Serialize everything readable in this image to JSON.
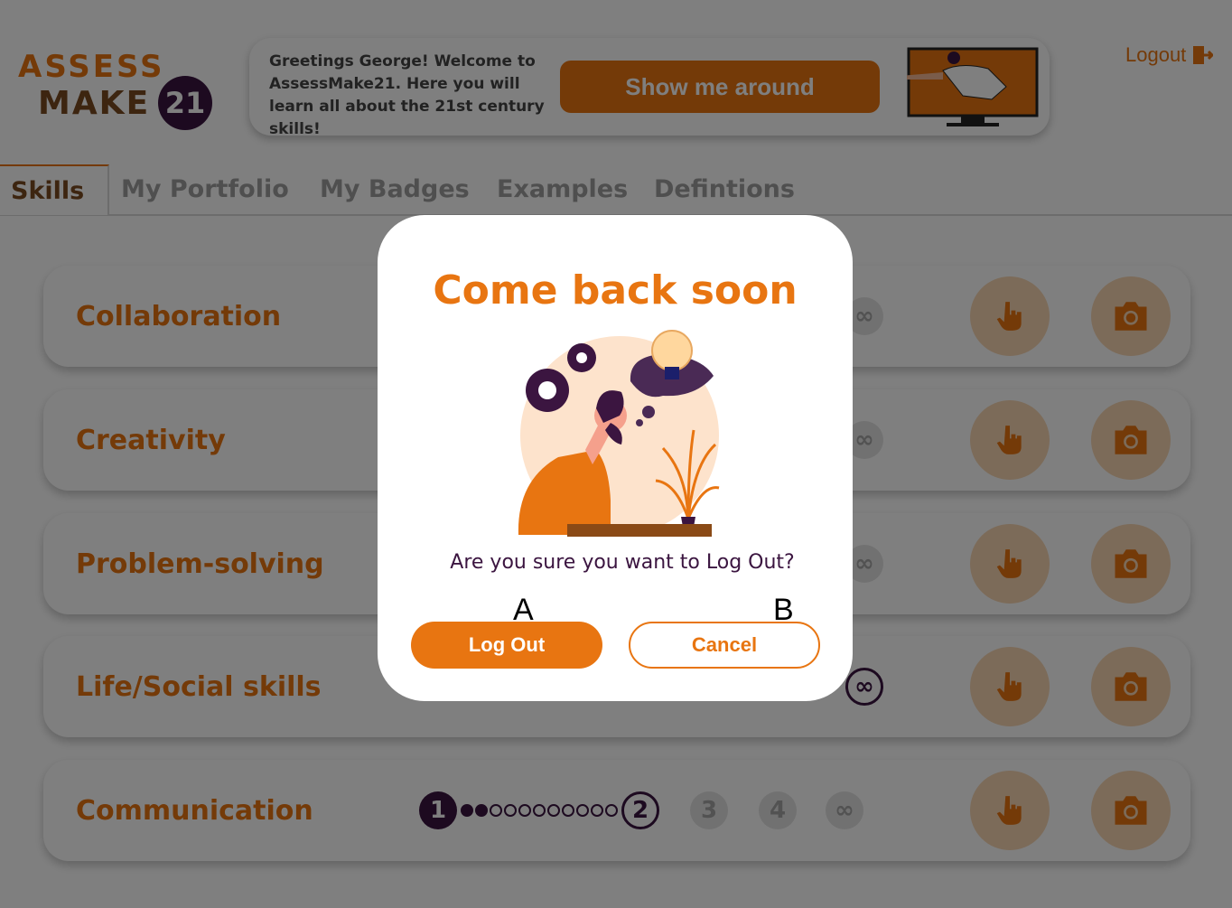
{
  "header": {
    "logo_line1": "ASSESS",
    "logo_line2": "MAKE",
    "logo_badge": "21",
    "greeting": "Greetings George! Welcome to AssessMake21. Here you will learn all about the 21st century skills!",
    "tour_button": "Show me around",
    "logout_link": "Logout"
  },
  "tabs": [
    {
      "label": "Skills",
      "active": true
    },
    {
      "label": "My Portfolio",
      "active": false
    },
    {
      "label": "My Badges",
      "active": false
    },
    {
      "label": "Examples",
      "active": false
    },
    {
      "label": "Defintions",
      "active": false
    }
  ],
  "skills": [
    {
      "name": "Collaboration"
    },
    {
      "name": "Creativity"
    },
    {
      "name": "Problem-solving"
    },
    {
      "name": "Life/Social skills"
    },
    {
      "name": "Communication"
    }
  ],
  "levels": {
    "l1": "1",
    "l2": "2",
    "l3": "3",
    "l4": "4",
    "infinity": "∞",
    "progress_dots_filled": 2,
    "progress_dots_total": 11
  },
  "modal": {
    "title": "Come back soon",
    "question": "Are you sure you want to Log Out?",
    "logout_button": "Log Out",
    "cancel_button": "Cancel",
    "marker_a": "A",
    "marker_b": "B"
  },
  "icons": {
    "logout": "logout-door-icon",
    "hand": "hand-pointer-icon",
    "camera": "camera-icon"
  },
  "colors": {
    "accent": "#e87511",
    "brand_dark": "#3b1540",
    "soft_orange": "#f8d6b3"
  }
}
